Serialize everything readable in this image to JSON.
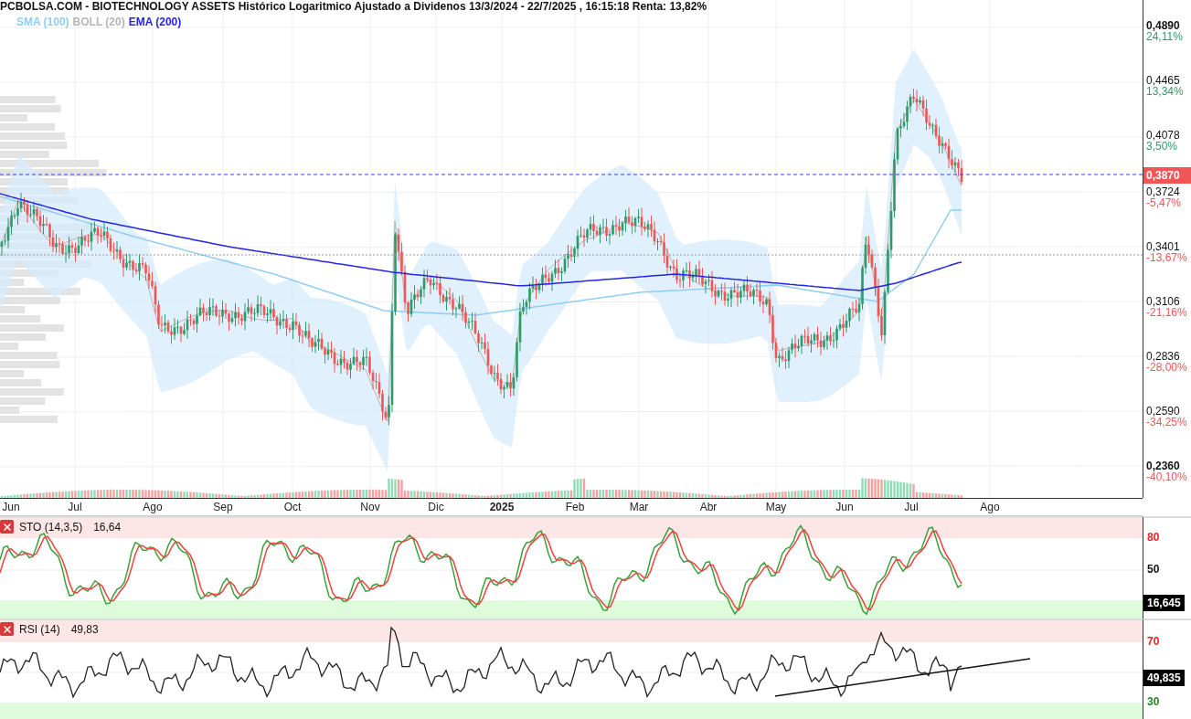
{
  "title": "PCBOLSA.COM - BIOTECHNOLOGY ASSETS Histórico Logaritmico Ajustado a Dividenos 13/3/2024 - 22/7/2025 , 16:15:18 Renta: 13,82%",
  "legend": [
    {
      "label": "SMA (100)",
      "color": "#90cdf4"
    },
    {
      "label": "BOLL (20)",
      "color": "#b5b5b5"
    },
    {
      "label": "EMA (200)",
      "color": "#2424e8"
    }
  ],
  "price_axis": [
    {
      "price": "0,4890",
      "change": "24,11%",
      "color": "#2e9a68"
    },
    {
      "price": "0,4465",
      "change": "13,34%",
      "color": "#2e9a68"
    },
    {
      "price": "0,4078",
      "change": "3,50%",
      "color": "#2e9a68"
    },
    {
      "price": "0,3724",
      "change": "-5,47%",
      "color": "#f05555"
    },
    {
      "price": "0,3401",
      "change": "-13,67%",
      "color": "#f05555"
    },
    {
      "price": "0,3106",
      "change": "-21,16%",
      "color": "#f05555"
    },
    {
      "price": "0,2836",
      "change": "-28,00%",
      "color": "#f05555"
    },
    {
      "price": "0,2590",
      "change": "-34,25%",
      "color": "#f05555"
    },
    {
      "price": "0,2360",
      "change": "-40,10%",
      "color": "#f05555"
    }
  ],
  "current_price": "0,3870",
  "months": [
    {
      "label": "Jun",
      "kind": "month"
    },
    {
      "label": "Jul",
      "kind": "month"
    },
    {
      "label": "Ago",
      "kind": "month"
    },
    {
      "label": "Sep",
      "kind": "month"
    },
    {
      "label": "Oct",
      "kind": "month"
    },
    {
      "label": "Nov",
      "kind": "month"
    },
    {
      "label": "Dic",
      "kind": "month"
    },
    {
      "label": "2025",
      "kind": "year"
    },
    {
      "label": "Feb",
      "kind": "month"
    },
    {
      "label": "Mar",
      "kind": "month"
    },
    {
      "label": "Abr",
      "kind": "month"
    },
    {
      "label": "May",
      "kind": "month"
    },
    {
      "label": "Jun",
      "kind": "month"
    },
    {
      "label": "Jul",
      "kind": "month"
    },
    {
      "label": "Ago",
      "kind": "month"
    }
  ],
  "indicators": [
    {
      "kind": "stochastic",
      "name": "STO (14,3,5)",
      "value": "16,64",
      "levels": [
        {
          "label": "80",
          "kind": "upper"
        },
        {
          "label": "50",
          "kind": "mid"
        }
      ],
      "readout": "16,645"
    },
    {
      "kind": "rsi",
      "name": "RSI (14)",
      "value": "49,83",
      "levels": [
        {
          "label": "70",
          "kind": "upper"
        },
        {
          "label": "30",
          "kind": "lower"
        }
      ],
      "readout": "49,835"
    }
  ]
}
